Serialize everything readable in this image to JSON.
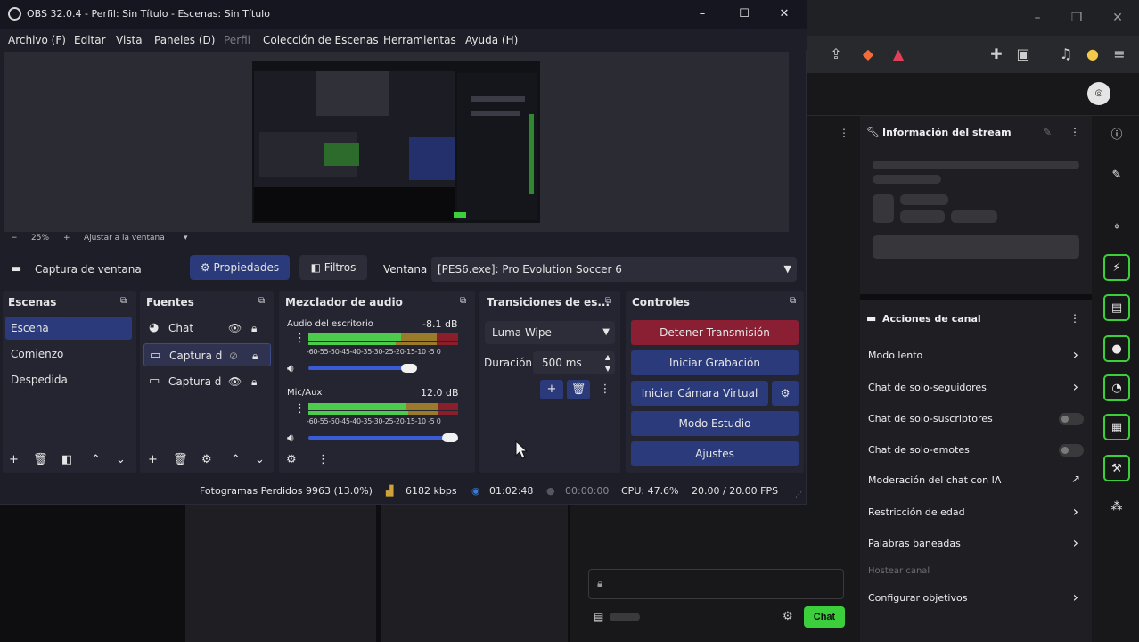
{
  "obs": {
    "window_title": "OBS 32.0.4 - Perfil: Sin Título - Escenas: Sin Título",
    "menu": [
      "Archivo (F)",
      "Editar",
      "Vista",
      "Paneles (D)",
      "Perfil",
      "Colección de Escenas",
      "Herramientas",
      "Ayuda (H)"
    ],
    "zoom": {
      "minus": "−",
      "level": "25%",
      "plus": "+",
      "fit": "Ajustar a la ventana",
      "arrow": "▾"
    },
    "source_bar": {
      "source_name": "Captura de ventana",
      "properties": "Propiedades",
      "filters": "Filtros",
      "window_label": "Ventana",
      "window_value": "[PES6.exe]: Pro Evolution Soccer 6"
    },
    "docks": {
      "scenes": {
        "title": "Escenas",
        "items": [
          "Escena",
          "Comienzo",
          "Despedida"
        ]
      },
      "sources": {
        "title": "Fuentes",
        "items": [
          {
            "name": "Chat",
            "icon": "browser-icon",
            "visible": true
          },
          {
            "name": "Captura de",
            "icon": "window-capture-icon",
            "visible": false
          },
          {
            "name": "Captura de",
            "icon": "monitor-icon",
            "visible": true
          }
        ]
      },
      "mixer": {
        "title": "Mezclador de audio",
        "channels": [
          {
            "name": "Audio del escritorio",
            "db": "-8.1 dB",
            "level": 0.62,
            "volume": 0.72
          },
          {
            "name": "Mic/Aux",
            "db": "12.0 dB",
            "level": 0.7,
            "volume": 0.98
          }
        ],
        "ticks": "-60-55-50-45-40-35-30-25-20-15-10 -5  0"
      },
      "transitions": {
        "title": "Transiciones de es...",
        "selected": "Luma Wipe",
        "duration_label": "Duración",
        "duration_value": "500 ms"
      },
      "controls": {
        "title": "Controles",
        "stop_stream": "Detener Transmisión",
        "start_recording": "Iniciar Grabación",
        "start_virtual_cam": "Iniciar Cámara Virtual",
        "studio_mode": "Modo Estudio",
        "settings": "Ajustes"
      }
    },
    "status": {
      "dropped_frames": "Fotogramas Perdidos 9963 (13.0%)",
      "bitrate": "6182 kbps",
      "stream_time": "01:02:48",
      "rec_time": "00:00:00",
      "cpu": "CPU: 47.6%",
      "fps": "20.00 / 20.00 FPS"
    }
  },
  "stream_panel": {
    "info_title": "Información del stream",
    "actions_title": "Acciones de canal",
    "actions": [
      {
        "label": "Modo lento",
        "type": "chevron"
      },
      {
        "label": "Chat de solo-seguidores",
        "type": "chevron"
      },
      {
        "label": "Chat de solo-suscriptores",
        "type": "toggle"
      },
      {
        "label": "Chat de solo-emotes",
        "type": "toggle"
      },
      {
        "label": "Moderación del chat con IA",
        "type": "external"
      },
      {
        "label": "Restricción de edad",
        "type": "chevron"
      },
      {
        "label": "Palabras baneadas",
        "type": "chevron"
      },
      {
        "label": "Hostear canal",
        "type": "disabled"
      },
      {
        "label": "Configurar objetivos",
        "type": "chevron"
      }
    ]
  },
  "chat": {
    "send_label": "Chat"
  },
  "colors": {
    "accent_green": "#3bcf3b",
    "obs_blue": "#2a3a7a",
    "obs_red": "#8a1f34"
  }
}
